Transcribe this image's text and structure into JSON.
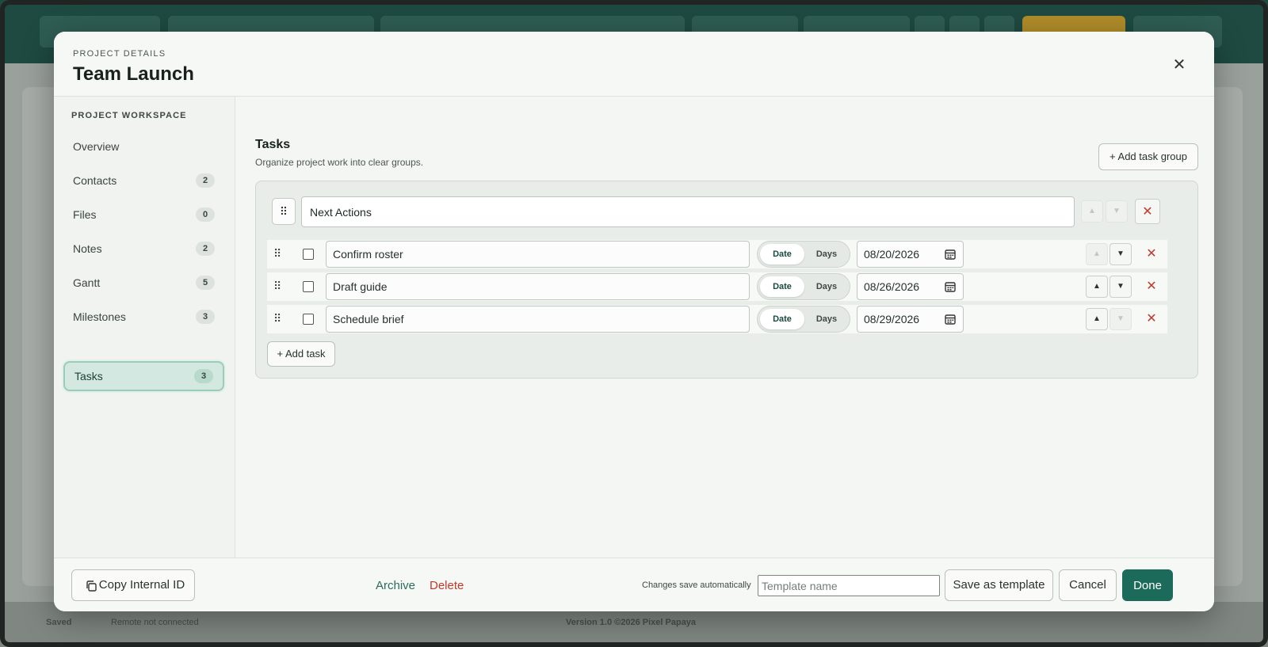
{
  "background": {
    "status_saved": "Saved",
    "status_remote": "Remote not connected",
    "status_version": "Version 1.0 ©2026 Pixel Papaya"
  },
  "modal": {
    "eyebrow": "PROJECT DETAILS",
    "title": "Team Launch",
    "close_icon": "close-icon"
  },
  "sidebar": {
    "heading": "PROJECT WORKSPACE",
    "items": [
      {
        "label": "Overview",
        "count": ""
      },
      {
        "label": "Contacts",
        "count": "2"
      },
      {
        "label": "Files",
        "count": "0"
      },
      {
        "label": "Notes",
        "count": "2"
      },
      {
        "label": "Gantt",
        "count": "5"
      },
      {
        "label": "Milestones",
        "count": "3"
      },
      {
        "label": "Tasks",
        "count": "3",
        "active": true
      }
    ]
  },
  "tasks_section": {
    "title": "Tasks",
    "subtitle": "Organize project work into clear groups.",
    "add_group_label": "+ Add task group",
    "group": {
      "name": "Next Actions",
      "tasks": [
        {
          "name": "Confirm roster",
          "mode_date": "Date",
          "mode_days": "Days",
          "date": "08/20/2026",
          "checked": false
        },
        {
          "name": "Draft guide",
          "mode_date": "Date",
          "mode_days": "Days",
          "date": "08/26/2026",
          "checked": false
        },
        {
          "name": "Schedule brief",
          "mode_date": "Date",
          "mode_days": "Days",
          "date": "08/29/2026",
          "checked": false
        }
      ],
      "add_task_label": "+ Add task"
    }
  },
  "footer": {
    "copy_id_label": "Copy Internal ID",
    "archive_label": "Archive",
    "delete_label": "Delete",
    "autosave_text": "Changes save automatically",
    "template_placeholder": "Template name",
    "save_template_label": "Save as template",
    "cancel_label": "Cancel",
    "done_label": "Done"
  },
  "colors": {
    "accent": "#1c6b5a",
    "danger": "#c0392b",
    "archive": "#2d6b5c"
  }
}
